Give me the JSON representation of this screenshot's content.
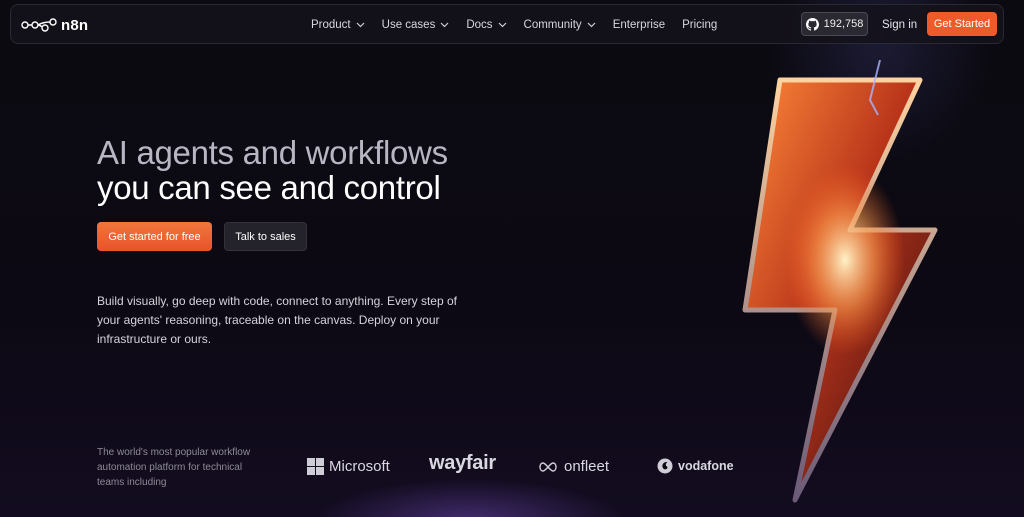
{
  "brand": {
    "name": "n8n"
  },
  "nav": {
    "items": [
      {
        "label": "Product",
        "has_dropdown": true
      },
      {
        "label": "Use cases",
        "has_dropdown": true
      },
      {
        "label": "Docs",
        "has_dropdown": true
      },
      {
        "label": "Community",
        "has_dropdown": true
      },
      {
        "label": "Enterprise",
        "has_dropdown": false
      },
      {
        "label": "Pricing",
        "has_dropdown": false
      }
    ],
    "github_stars": "192,758",
    "signin_label": "Sign in",
    "get_started_label": "Get Started"
  },
  "hero": {
    "title_line1": "AI agents and workflows",
    "title_line2": "you can see and control",
    "primary_cta": "Get started for free",
    "secondary_cta": "Talk to sales",
    "description": "Build visually, go deep with code, connect to anything. Every step of your agents' reasoning, traceable on the canvas. Deploy on your infrastructure or ours."
  },
  "trust": {
    "text": "The world's most popular workflow automation platform for technical teams including",
    "logos": [
      "Microsoft",
      "wayfair",
      "onfleet",
      "vodafone"
    ]
  },
  "colors": {
    "accent": "#ee5a2a",
    "background": "#0a0810"
  }
}
